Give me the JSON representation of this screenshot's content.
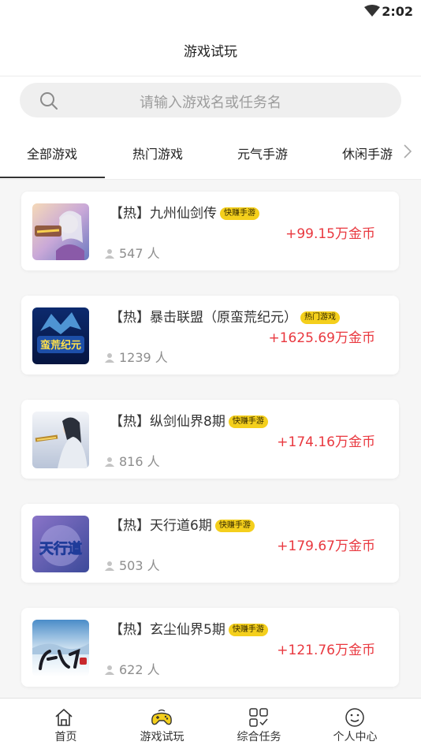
{
  "status": {
    "time": "2:02",
    "wifi_icon": "wifi-icon"
  },
  "header": {
    "title": "游戏试玩"
  },
  "search": {
    "placeholder": "请输入游戏名或任务名",
    "icon": "search-icon"
  },
  "tabs": [
    {
      "label": "全部游戏",
      "active": true
    },
    {
      "label": "热门游戏"
    },
    {
      "label": "元气手游"
    },
    {
      "label": "休闲手游"
    }
  ],
  "games": [
    {
      "title": "【热】九州仙剑传",
      "badge": "快赚手游",
      "reward": "+99.15万金币",
      "people": "547 人"
    },
    {
      "title": "【热】暴击联盟（原蛮荒纪元）",
      "badge": "热门游戏",
      "reward": "+1625.69万金币",
      "people": "1239 人",
      "logo_text": "蛮荒纪元"
    },
    {
      "title": "【热】纵剑仙界8期",
      "badge": "快赚手游",
      "reward": "+174.16万金币",
      "people": "816 人"
    },
    {
      "title": "【热】天行道6期",
      "badge": "快赚手游",
      "reward": "+179.67万金币",
      "people": "503 人",
      "logo_text": "天行道"
    },
    {
      "title": "【热】玄尘仙界5期",
      "badge": "快赚手游",
      "reward": "+121.76万金币",
      "people": "622 人"
    }
  ],
  "bottom_nav": [
    {
      "label": "首页",
      "icon": "home-icon"
    },
    {
      "label": "游戏试玩",
      "icon": "gamepad-icon",
      "active": true
    },
    {
      "label": "综合任务",
      "icon": "tasks-icon"
    },
    {
      "label": "个人中心",
      "icon": "smiley-icon"
    }
  ],
  "colors": {
    "reward": "#e9383f",
    "badge": "#f4cf1c",
    "background": "#f6f6f6"
  }
}
